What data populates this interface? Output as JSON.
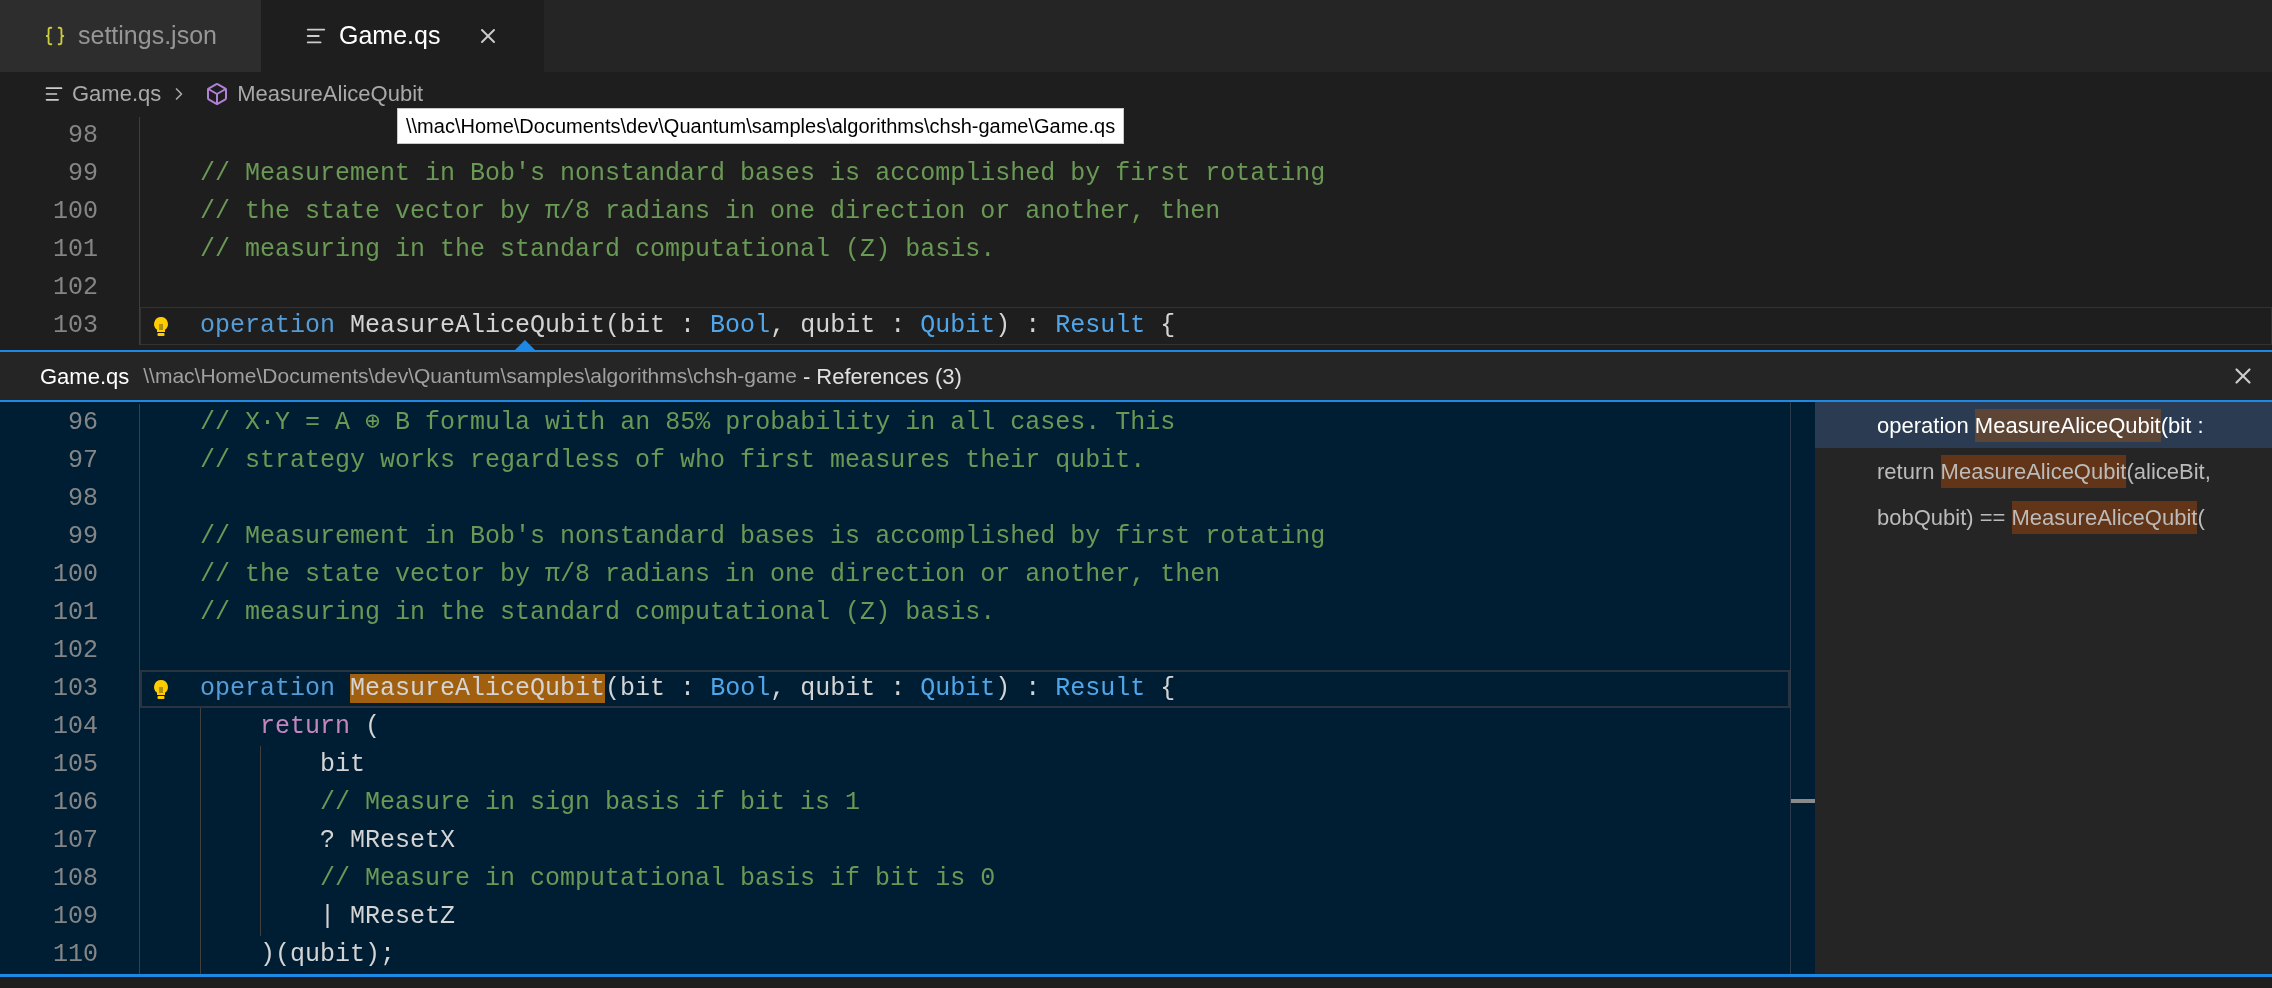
{
  "tabs": [
    {
      "label": "settings.json",
      "kind": "json",
      "selected": false
    },
    {
      "label": "Game.qs",
      "kind": "text",
      "selected": true
    }
  ],
  "breadcrumb": [
    {
      "label": "Game.qs",
      "kind": "file"
    },
    {
      "label": "MeasureAliceQubit",
      "kind": "symbol"
    }
  ],
  "tooltip": "\\\\mac\\Home\\Documents\\dev\\Quantum\\samples\\algorithms\\chsh-game\\Game.qs",
  "editor": {
    "lines": [
      {
        "number": "98",
        "current": false
      },
      {
        "number": "99",
        "current": false,
        "tokens": [
          {
            "kind": "comment",
            "text": "    // Measurement in Bob's nonstandard bases is accomplished by first rotating"
          }
        ]
      },
      {
        "number": "100",
        "current": false,
        "tokens": [
          {
            "kind": "comment",
            "text": "    // the state vector by π/8 radians in one direction or another, then"
          }
        ]
      },
      {
        "number": "101",
        "current": false,
        "tokens": [
          {
            "kind": "comment",
            "text": "    // measuring in the standard computational (Z) basis."
          }
        ]
      },
      {
        "number": "102",
        "current": false
      },
      {
        "number": "103",
        "current": true,
        "lightbulb": true,
        "tokens": [
          {
            "kind": "keyword",
            "text": "    operation"
          },
          {
            "kind": "plain",
            "text": " MeasureAliceQubit(bit : "
          },
          {
            "kind": "type",
            "text": "Bool"
          },
          {
            "kind": "plain",
            "text": ", qubit : "
          },
          {
            "kind": "type",
            "text": "Qubit"
          },
          {
            "kind": "plain",
            "text": ") : "
          },
          {
            "kind": "type",
            "text": "Result"
          },
          {
            "kind": "plain",
            "text": " {"
          }
        ]
      }
    ]
  },
  "peek": {
    "file": "Game.qs",
    "path": "\\\\mac\\Home\\Documents\\dev\\Quantum\\samples\\algorithms\\chsh-game",
    "title": "- References (3)",
    "lines": [
      {
        "number": "96",
        "current": false,
        "tokens": [
          {
            "kind": "comment",
            "text": "    // X·Y = A ⊕ B formula with an 85% probability in all cases. This"
          }
        ]
      },
      {
        "number": "97",
        "current": false,
        "tokens": [
          {
            "kind": "comment",
            "text": "    // strategy works regardless of who first measures their qubit."
          }
        ]
      },
      {
        "number": "98",
        "current": false
      },
      {
        "number": "99",
        "current": false,
        "tokens": [
          {
            "kind": "comment",
            "text": "    // Measurement in Bob's nonstandard bases is accomplished by first rotating"
          }
        ]
      },
      {
        "number": "100",
        "current": false,
        "tokens": [
          {
            "kind": "comment",
            "text": "    // the state vector by π/8 radians in one direction or another, then"
          }
        ]
      },
      {
        "number": "101",
        "current": false,
        "tokens": [
          {
            "kind": "comment",
            "text": "    // measuring in the standard computational (Z) basis."
          }
        ]
      },
      {
        "number": "102",
        "current": false
      },
      {
        "number": "103",
        "current": true,
        "lightbulb": true,
        "tokens": [
          {
            "kind": "keyword",
            "text": "    operation "
          },
          {
            "kind": "match",
            "text": "MeasureAliceQubit"
          },
          {
            "kind": "plain",
            "text": "(bit : "
          },
          {
            "kind": "type",
            "text": "Bool"
          },
          {
            "kind": "plain",
            "text": ", qubit : "
          },
          {
            "kind": "type",
            "text": "Qubit"
          },
          {
            "kind": "plain",
            "text": ") : "
          },
          {
            "kind": "type",
            "text": "Result"
          },
          {
            "kind": "plain",
            "text": " {"
          }
        ]
      },
      {
        "number": "104",
        "current": false,
        "tokens": [
          {
            "kind": "control",
            "text": "        return"
          },
          {
            "kind": "plain",
            "text": " ("
          }
        ]
      },
      {
        "number": "105",
        "current": false,
        "tokens": [
          {
            "kind": "plain",
            "text": "            bit"
          }
        ]
      },
      {
        "number": "106",
        "current": false,
        "tokens": [
          {
            "kind": "comment",
            "text": "            // Measure in sign basis if bit is 1"
          }
        ]
      },
      {
        "number": "107",
        "current": false,
        "tokens": [
          {
            "kind": "plain",
            "text": "            ? MResetX"
          }
        ]
      },
      {
        "number": "108",
        "current": false,
        "tokens": [
          {
            "kind": "comment",
            "text": "            // Measure in computational basis if bit is 0"
          }
        ]
      },
      {
        "number": "109",
        "current": false,
        "tokens": [
          {
            "kind": "plain",
            "text": "            | MResetZ"
          }
        ]
      },
      {
        "number": "110",
        "current": false,
        "tokens": [
          {
            "kind": "plain",
            "text": "        )(qubit);"
          }
        ]
      }
    ],
    "references": [
      {
        "before": "operation ",
        "match": "MeasureAliceQubit",
        "after": "(bit :",
        "selected": true
      },
      {
        "before": "return ",
        "match": "MeasureAliceQubit",
        "after": "(aliceBit,",
        "selected": false
      },
      {
        "before": "bobQubit) == ",
        "match": "MeasureAliceQubit",
        "after": "(",
        "selected": false
      }
    ]
  }
}
